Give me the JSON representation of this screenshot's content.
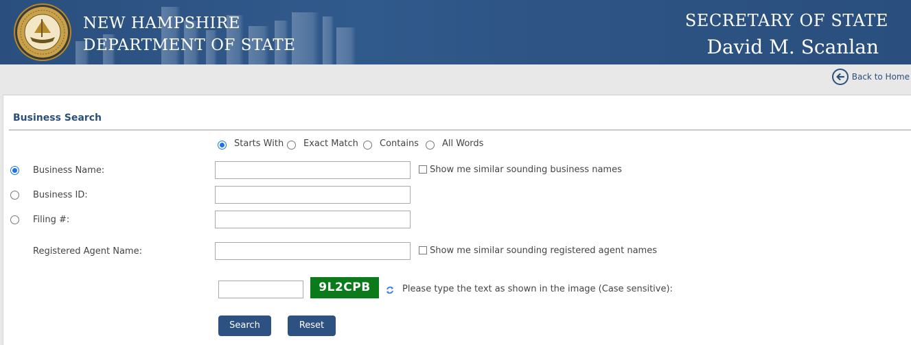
{
  "header": {
    "dept_line1": "NEW HAMPSHIRE",
    "dept_line2": "DEPARTMENT OF STATE",
    "office_title": "SECRETARY OF STATE",
    "official_name": "David M. Scanlan",
    "seal_text": "SEAL OF THE STATE OF NEW HAMPSHIRE 1776",
    "brand_color": "#2a4f7e"
  },
  "nav": {
    "back_home_label": "Back to Home"
  },
  "form": {
    "title": "Business Search",
    "match_modes": [
      {
        "label": "Starts With",
        "selected": true
      },
      {
        "label": "Exact Match",
        "selected": false
      },
      {
        "label": "Contains",
        "selected": false
      },
      {
        "label": "All Words",
        "selected": false
      }
    ],
    "fields": {
      "business_name": {
        "label": "Business Name:",
        "value": "",
        "selected": true
      },
      "business_id": {
        "label": "Business ID:",
        "value": "",
        "selected": false
      },
      "filing_number": {
        "label": "Filing #:",
        "value": "",
        "selected": false
      },
      "registered_agent": {
        "label": "Registered Agent Name:",
        "value": ""
      }
    },
    "similar_business": {
      "label": "Show me similar sounding business names",
      "checked": false
    },
    "similar_agent": {
      "label": "Show me similar sounding registered agent names",
      "checked": false
    },
    "captcha": {
      "code": "9L2CPB",
      "input_value": "",
      "instruction": "Please type the text as shown in the image (Case sensitive):"
    },
    "buttons": {
      "search_label": "Search",
      "reset_label": "Reset"
    }
  }
}
